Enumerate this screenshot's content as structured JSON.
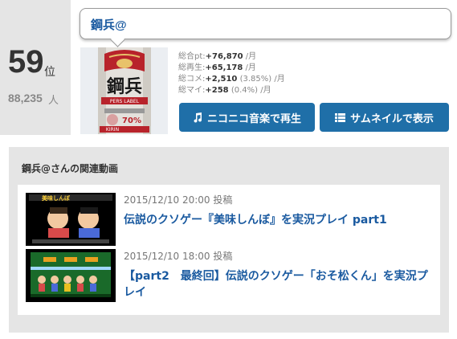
{
  "rank": {
    "number": "59",
    "suffix": "位"
  },
  "listeners": {
    "count": "88,235",
    "suffix": "人"
  },
  "artist": {
    "name": "鋼兵@"
  },
  "thumbnail": {
    "can_top_text": "KIRIN",
    "can_main_text": "鋼兵",
    "can_sub_text": "PERS LABEL"
  },
  "stats": [
    {
      "label": "総合pt:",
      "value": "+76,870",
      "pct": "",
      "unit": "/月"
    },
    {
      "label": "総再生:",
      "value": "+65,178",
      "pct": "",
      "unit": "/月"
    },
    {
      "label": "総コメ:",
      "value": "+2,510",
      "pct": "(3.85%)",
      "unit": "/月"
    },
    {
      "label": "総マイ:",
      "value": "+258",
      "pct": "(0.4%)",
      "unit": "/月"
    }
  ],
  "buttons": {
    "play_label": "ニコニコ音楽で再生",
    "thumbnails_label": "サムネイルで表示"
  },
  "related": {
    "heading": "鋼兵@さんの関連動画",
    "items": [
      {
        "date": "2015/12/10 20:00 投稿",
        "title": "伝説のクソゲー『美味しんぼ』を実況プレイ part1",
        "thumb_text": "美味しんぼ"
      },
      {
        "date": "2015/12/10 18:00 投稿",
        "title": "【part2　最終回】伝説のクソゲー「おそ松くん」を実況プレイ",
        "thumb_text": ""
      }
    ]
  },
  "colors": {
    "accent": "#1f6fa8",
    "link": "#1a5aa0",
    "panel": "#e5e5e5"
  }
}
